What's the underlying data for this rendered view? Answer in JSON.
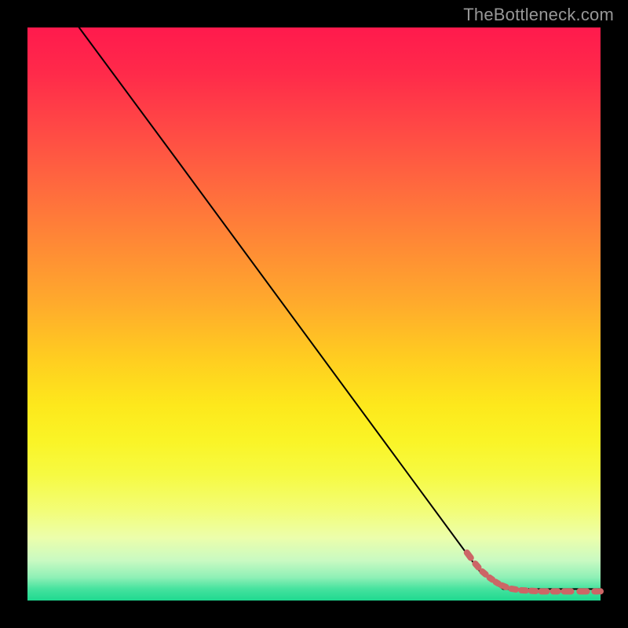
{
  "watermark": "TheBottleneck.com",
  "chart_data": {
    "type": "line",
    "title": "",
    "xlabel": "",
    "ylabel": "",
    "xlim": [
      0,
      100
    ],
    "ylim": [
      0,
      100
    ],
    "grid": false,
    "legend": false,
    "series": [
      {
        "name": "curve",
        "color": "#000000",
        "style": "solid",
        "x": [
          9,
          26,
          79,
          83,
          100
        ],
        "y": [
          100,
          77,
          5,
          2,
          2
        ]
      },
      {
        "name": "dotted-tail",
        "color": "#cc6666",
        "style": "dotted",
        "x": [
          76.5,
          78.0,
          79.2,
          80.5,
          81.6,
          82.6,
          84.2,
          86.0,
          87.7,
          89.4,
          91.5,
          93.3,
          96.0,
          98.8,
          100
        ],
        "y": [
          8.6,
          6.6,
          5.2,
          4.1,
          3.3,
          2.7,
          2.1,
          1.8,
          1.7,
          1.6,
          1.6,
          1.6,
          1.6,
          1.6,
          1.6
        ]
      }
    ]
  }
}
